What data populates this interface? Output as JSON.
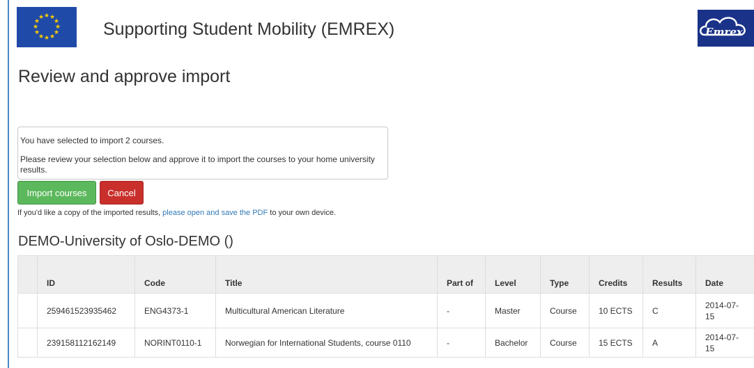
{
  "header": {
    "site_title": "Supporting Student Mobility (EMREX)",
    "logo_text": "Emrex"
  },
  "page_title": "Review and approve import",
  "info": {
    "line1": "You have selected to import 2 courses.",
    "line2": "Please review your selection below and approve it to import the courses to your home university results."
  },
  "buttons": {
    "import_label": "Import courses",
    "cancel_label": "Cancel"
  },
  "pdf_note": {
    "prefix": "If you'd like a copy of the imported results, ",
    "link": "please open and save the PDF",
    "suffix": " to your own device."
  },
  "university": "DEMO-University of Oslo-DEMO ()",
  "table": {
    "headers": [
      "",
      "ID",
      "Code",
      "Title",
      "Part of",
      "Level",
      "Type",
      "Credits",
      "Results",
      "Date"
    ],
    "rows": [
      [
        "",
        "259461523935462",
        "ENG4373-1",
        "Multicultural American Literature",
        "-",
        "Master",
        "Course",
        "10 ECTS",
        "C",
        "2014-07-15"
      ],
      [
        "",
        "239158112162149",
        "NORINT0110-1",
        "Norwegian for International Students, course 0110",
        "-",
        "Bachelor",
        "Course",
        "15 ECTS",
        "A",
        "2014-07-15"
      ]
    ]
  },
  "colors": {
    "eu_blue": "#1f4aa8",
    "eu_star": "#ffcc00",
    "logo_blue": "#1a3288",
    "import_green": "#5cb85c",
    "cancel_red": "#c9302c",
    "link_blue": "#337ab7"
  }
}
